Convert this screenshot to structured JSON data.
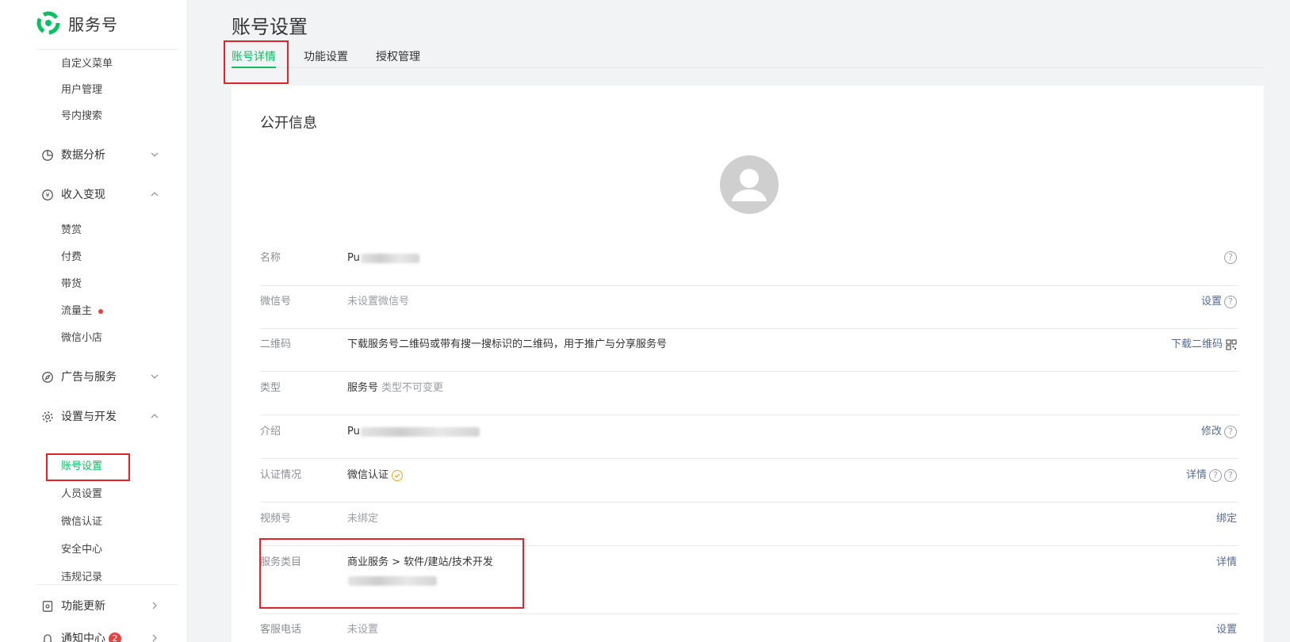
{
  "brand": {
    "name": "服务号",
    "accent": "#07c160"
  },
  "sidebar": {
    "top_items": [
      {
        "label": "自定义菜单"
      },
      {
        "label": "用户管理"
      },
      {
        "label": "号内搜索"
      }
    ],
    "groups": {
      "data_analysis": {
        "label": "数据分析",
        "icon": "pie-chart-icon",
        "expanded": false
      },
      "monetization": {
        "label": "收入变现",
        "icon": "yuan-icon",
        "expanded": true,
        "items": [
          {
            "label": "赞赏"
          },
          {
            "label": "付费"
          },
          {
            "label": "带货"
          },
          {
            "label": "流量主",
            "has_dot": true
          },
          {
            "label": "微信小店"
          }
        ]
      },
      "ads": {
        "label": "广告与服务",
        "icon": "compass-icon",
        "expanded": false
      },
      "settings_dev": {
        "label": "设置与开发",
        "icon": "gear-icon",
        "expanded": true,
        "items": [
          {
            "label": "账号设置",
            "active": true
          },
          {
            "label": "人员设置"
          },
          {
            "label": "微信认证"
          },
          {
            "label": "安全中心"
          },
          {
            "label": "违规记录"
          }
        ]
      },
      "updates": {
        "label": "功能更新",
        "icon": "update-icon"
      },
      "notifications": {
        "label": "通知中心",
        "icon": "bell-icon",
        "badge": "2"
      }
    }
  },
  "header": {
    "title": "账号设置",
    "tabs": [
      {
        "label": "账号详情",
        "active": true
      },
      {
        "label": "功能设置"
      },
      {
        "label": "授权管理"
      }
    ]
  },
  "panel": {
    "title": "公开信息",
    "rows": {
      "name": {
        "label": "名称",
        "value": "Pu"
      },
      "wechat_id": {
        "label": "微信号",
        "value": "未设置微信号",
        "action": "设置"
      },
      "qrcode": {
        "label": "二维码",
        "value": "下载服务号二维码或带有搜一搜标识的二维码，用于推广与分享服务号",
        "action": "下载二维码"
      },
      "type": {
        "label": "类型",
        "value": "服务号",
        "note": "类型不可变更"
      },
      "intro": {
        "label": "介绍",
        "value": "Pu",
        "action": "修改"
      },
      "verify": {
        "label": "认证情况",
        "value": "微信认证",
        "action": "详情"
      },
      "channels": {
        "label": "视频号",
        "value": "未绑定",
        "action": "绑定"
      },
      "category": {
        "label": "服务类目",
        "value": "商业服务 > 软件/建站/技术开发",
        "action": "详情"
      },
      "phone": {
        "label": "客服电话",
        "value": "未设置",
        "action": "设置"
      }
    }
  },
  "highlight_color": "#e0242c"
}
